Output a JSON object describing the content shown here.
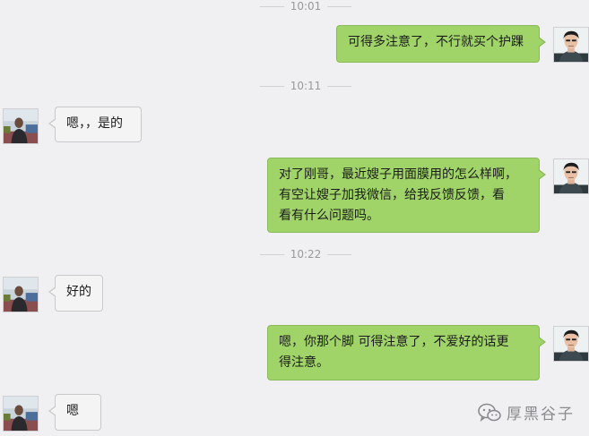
{
  "timestamps": [
    "10:01",
    "10:11",
    "10:22"
  ],
  "messages": [
    {
      "side": "right",
      "text": "可得多注意了，不行就买个护踝"
    },
    {
      "side": "left",
      "text": "嗯，，是的"
    },
    {
      "side": "right",
      "lines": [
        "对了刚哥，最近嫂子用面膜用的怎么样啊，",
        "有空让嫂子加我微信，给我反馈反馈，看",
        "看有什么问题吗。"
      ]
    },
    {
      "side": "left",
      "text": "好的"
    },
    {
      "side": "right",
      "lines": [
        "嗯，你那个脚 可得注意了，不爱好的话更",
        "得注意。"
      ]
    },
    {
      "side": "left",
      "text": "嗯"
    }
  ],
  "watermark": {
    "text": "厚黑谷子",
    "icon": "wechat-icon"
  },
  "colors": {
    "outgoing_bubble": "#a0d468",
    "incoming_bubble": "#f4f4f4",
    "background": "#f0f0f3"
  }
}
